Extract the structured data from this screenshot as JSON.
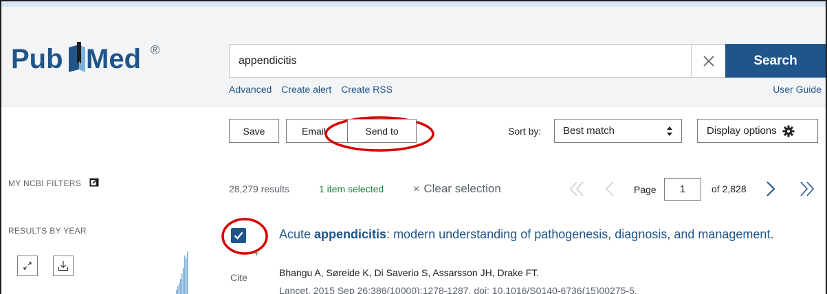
{
  "logo": {
    "word_left": "Pub",
    "word_right": "Med",
    "registered": "®"
  },
  "search": {
    "value": "appendicitis",
    "button_label": "Search",
    "links": [
      "Advanced",
      "Create alert",
      "Create RSS"
    ],
    "user_guide": "User Guide"
  },
  "toolbar": {
    "save_label": "Save",
    "email_label": "Email",
    "send_to_label": "Send to",
    "sort_label": "Sort by:",
    "sort_value": "Best match",
    "display_options_label": "Display options"
  },
  "sidebar": {
    "filters_label": "MY NCBI FILTERS",
    "results_by_year_label": "RESULTS BY YEAR"
  },
  "results": {
    "count": "28,279 results",
    "selected": "1 item selected",
    "clear_selection": "Clear selection",
    "page_label": "Page",
    "page_value": "1",
    "page_of": "of 2,828"
  },
  "article": {
    "title_pre": "Acute ",
    "title_bold": "appendicitis",
    "title_post": ": modern understanding of pathogenesis, diagnosis, and management.",
    "cite_label": "Cite",
    "authors": "Bhangu A, Søreide K, Di Saverio S, Assarsson JH, Drake FT.",
    "citation": "Lancet. 2015 Sep 26;386(10000):1278-1287. doi: 10.1016/S0140-6736(15)00275-5."
  },
  "colors": {
    "brand": "#20558a",
    "annotation": "#d40000",
    "selected_green": "#1a7f37"
  }
}
